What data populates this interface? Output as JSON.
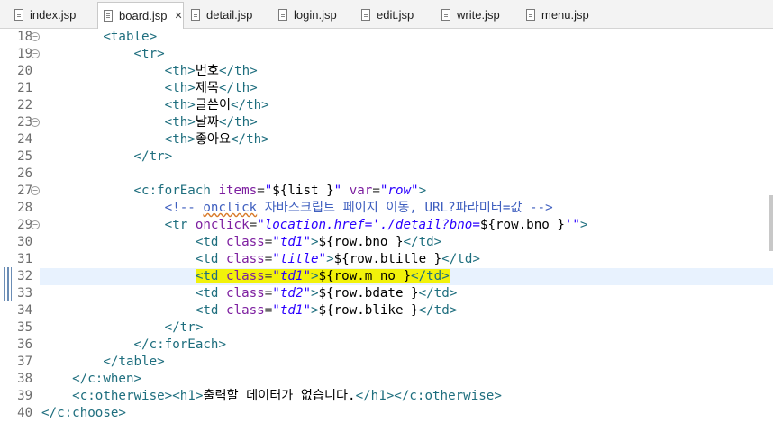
{
  "tabs": [
    {
      "label": "index.jsp",
      "active": false
    },
    {
      "label": "board.jsp",
      "active": true,
      "close": "✕"
    },
    {
      "label": "detail.jsp",
      "active": false
    },
    {
      "label": "login.jsp",
      "active": false
    },
    {
      "label": "edit.jsp",
      "active": false
    },
    {
      "label": "write.jsp",
      "active": false
    },
    {
      "label": "menu.jsp",
      "active": false
    }
  ],
  "editor": {
    "current_line": 32,
    "lines": [
      {
        "n": "18",
        "fold": true
      },
      {
        "n": "19",
        "fold": true
      },
      {
        "n": "20"
      },
      {
        "n": "21"
      },
      {
        "n": "22"
      },
      {
        "n": "23",
        "fold": true
      },
      {
        "n": "24"
      },
      {
        "n": "25"
      },
      {
        "n": "26"
      },
      {
        "n": "27",
        "fold": true
      },
      {
        "n": "28"
      },
      {
        "n": "29",
        "fold": true
      },
      {
        "n": "30"
      },
      {
        "n": "31"
      },
      {
        "n": "32"
      },
      {
        "n": "33"
      },
      {
        "n": "34"
      },
      {
        "n": "35"
      },
      {
        "n": "36"
      },
      {
        "n": "37"
      },
      {
        "n": "38"
      },
      {
        "n": "39"
      },
      {
        "n": "40"
      }
    ],
    "code": {
      "l18": {
        "tag": "<table>"
      },
      "l19": {
        "tag": "<tr>"
      },
      "l20": {
        "open": "<th>",
        "text": "번호",
        "close": "</th>"
      },
      "l21": {
        "open": "<th>",
        "text": "제목",
        "close": "</th>"
      },
      "l22": {
        "open": "<th>",
        "text": "글쓴이",
        "close": "</th>"
      },
      "l23": {
        "open": "<th>",
        "text": "날짜",
        "close": "</th>"
      },
      "l24": {
        "open": "<th>",
        "text": "좋아요",
        "close": "</th>"
      },
      "l25": {
        "tag": "</tr>"
      },
      "l27": {
        "open": "<c:forEach ",
        "attr1": "items",
        "eq1": "=",
        "val1a": "\"",
        "expr1": "${list }",
        "val1b": "\"",
        "attr2": " var",
        "eq2": "=",
        "val2": "\"row\"",
        "end": ">"
      },
      "l28": {
        "a": "<!-- ",
        "u": "onclick",
        "b": " 자바스크립트 페이지 이동, URL?파라미터=값 -->"
      },
      "l29": {
        "open": "<tr ",
        "attr": "onclick",
        "eq": "=",
        "val": "\"location.href='./detail?bno=",
        "expr": "${row.bno }",
        "valend": "'\"",
        "end": ">"
      },
      "l30": {
        "open": "<td ",
        "attr": "class",
        "eq": "=",
        "val": "\"td1\"",
        "gt": ">",
        "expr": "${row.bno }",
        "close": "</td>"
      },
      "l31": {
        "open": "<td ",
        "attr": "class",
        "eq": "=",
        "val": "\"title\"",
        "gt": ">",
        "expr": "${row.btitle }",
        "close": "</td>"
      },
      "l32": {
        "open": "<td ",
        "attr": "class",
        "eq": "=",
        "val": "\"td1\"",
        "gt": ">",
        "expr": "${row.m_no }",
        "close": "</td>"
      },
      "l33": {
        "open": "<td ",
        "attr": "class",
        "eq": "=",
        "val": "\"td2\"",
        "gt": ">",
        "expr": "${row.bdate }",
        "close": "</td>"
      },
      "l34": {
        "open": "<td ",
        "attr": "class",
        "eq": "=",
        "val": "\"td1\"",
        "gt": ">",
        "expr": "${row.blike }",
        "close": "</td>"
      },
      "l35": {
        "tag": "</tr>"
      },
      "l36": {
        "tag": "</c:forEach>"
      },
      "l37": {
        "tag": "</table>"
      },
      "l38": {
        "tag": "</c:when>"
      },
      "l39": {
        "open": "<c:otherwise><h1>",
        "text": "출력할 데이터가 없습니다.",
        "close": "</h1></c:otherwise>"
      },
      "l40": {
        "tag": "</c:choose>"
      }
    }
  }
}
